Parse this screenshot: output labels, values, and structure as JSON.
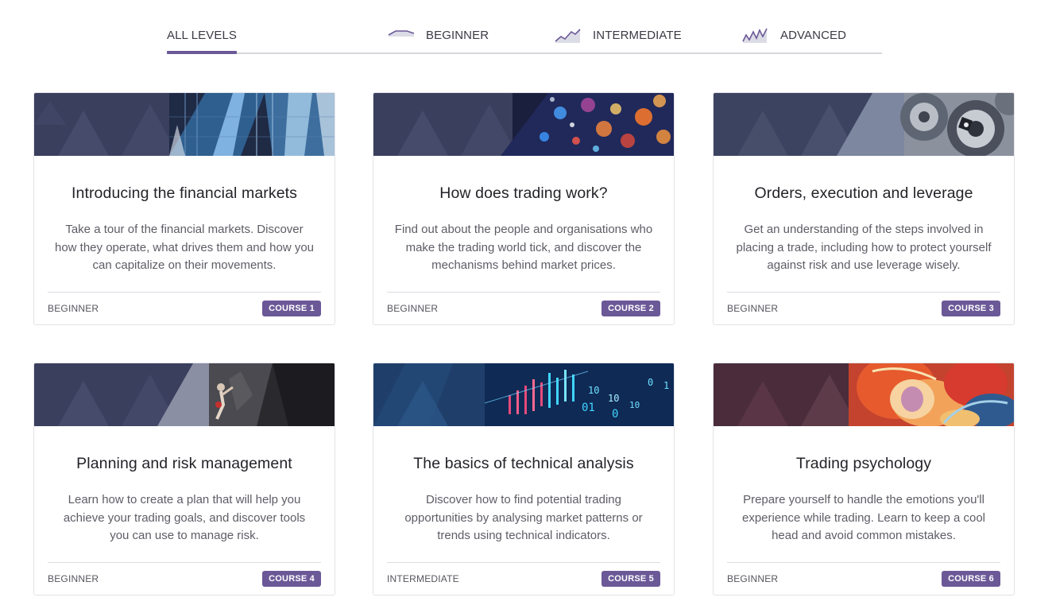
{
  "tabs": [
    {
      "label": "ALL LEVELS",
      "icon": "",
      "active": true
    },
    {
      "label": "BEGINNER",
      "icon": "beginner-level-icon",
      "active": false
    },
    {
      "label": "INTERMEDIATE",
      "icon": "intermediate-level-icon",
      "active": false
    },
    {
      "label": "ADVANCED",
      "icon": "advanced-level-icon",
      "active": false
    }
  ],
  "colors": {
    "accent": "#6b5897",
    "banner_base": "#3a4060",
    "text_dark": "#232329",
    "text_muted": "#5d5d66"
  },
  "courses": [
    {
      "title": "Introducing the financial markets",
      "description": "Take a tour of the financial markets. Discover how they operate, what drives them and how you can capitalize on their movements.",
      "level": "BEGINNER",
      "badge": "COURSE 1",
      "banner_image": "glass-skyscrapers"
    },
    {
      "title": "How does trading work?",
      "description": "Find out about the people and organisations who make the trading world tick, and discover the mechanisms behind market prices.",
      "level": "BEGINNER",
      "badge": "COURSE 2",
      "banner_image": "bokeh-market-lights"
    },
    {
      "title": "Orders, execution and leverage",
      "description": "Get an understanding of the steps involved in placing a trade, including how to protect yourself against risk and use leverage wisely.",
      "level": "BEGINNER",
      "badge": "COURSE 3",
      "banner_image": "metal-gears"
    },
    {
      "title": "Planning and risk management",
      "description": "Learn how to create a plan that will help you achieve your trading goals, and discover tools you can use to manage risk.",
      "level": "BEGINNER",
      "badge": "COURSE 4",
      "banner_image": "rock-climber"
    },
    {
      "title": "The basics of technical analysis",
      "description": "Discover how to find potential trading opportunities by analysing market patterns or trends using technical indicators.",
      "level": "INTERMEDIATE",
      "badge": "COURSE 5",
      "banner_image": "candlestick-binary-display",
      "banner_text": [
        "0",
        "10",
        "10",
        "01",
        "1",
        "10",
        "0"
      ]
    },
    {
      "title": "Trading psychology",
      "description": "Prepare yourself to handle the emotions you'll experience while trading. Learn to keep a cool head and avoid common mistakes.",
      "level": "BEGINNER",
      "badge": "COURSE 6",
      "banner_image": "abstract-painted-face"
    }
  ]
}
